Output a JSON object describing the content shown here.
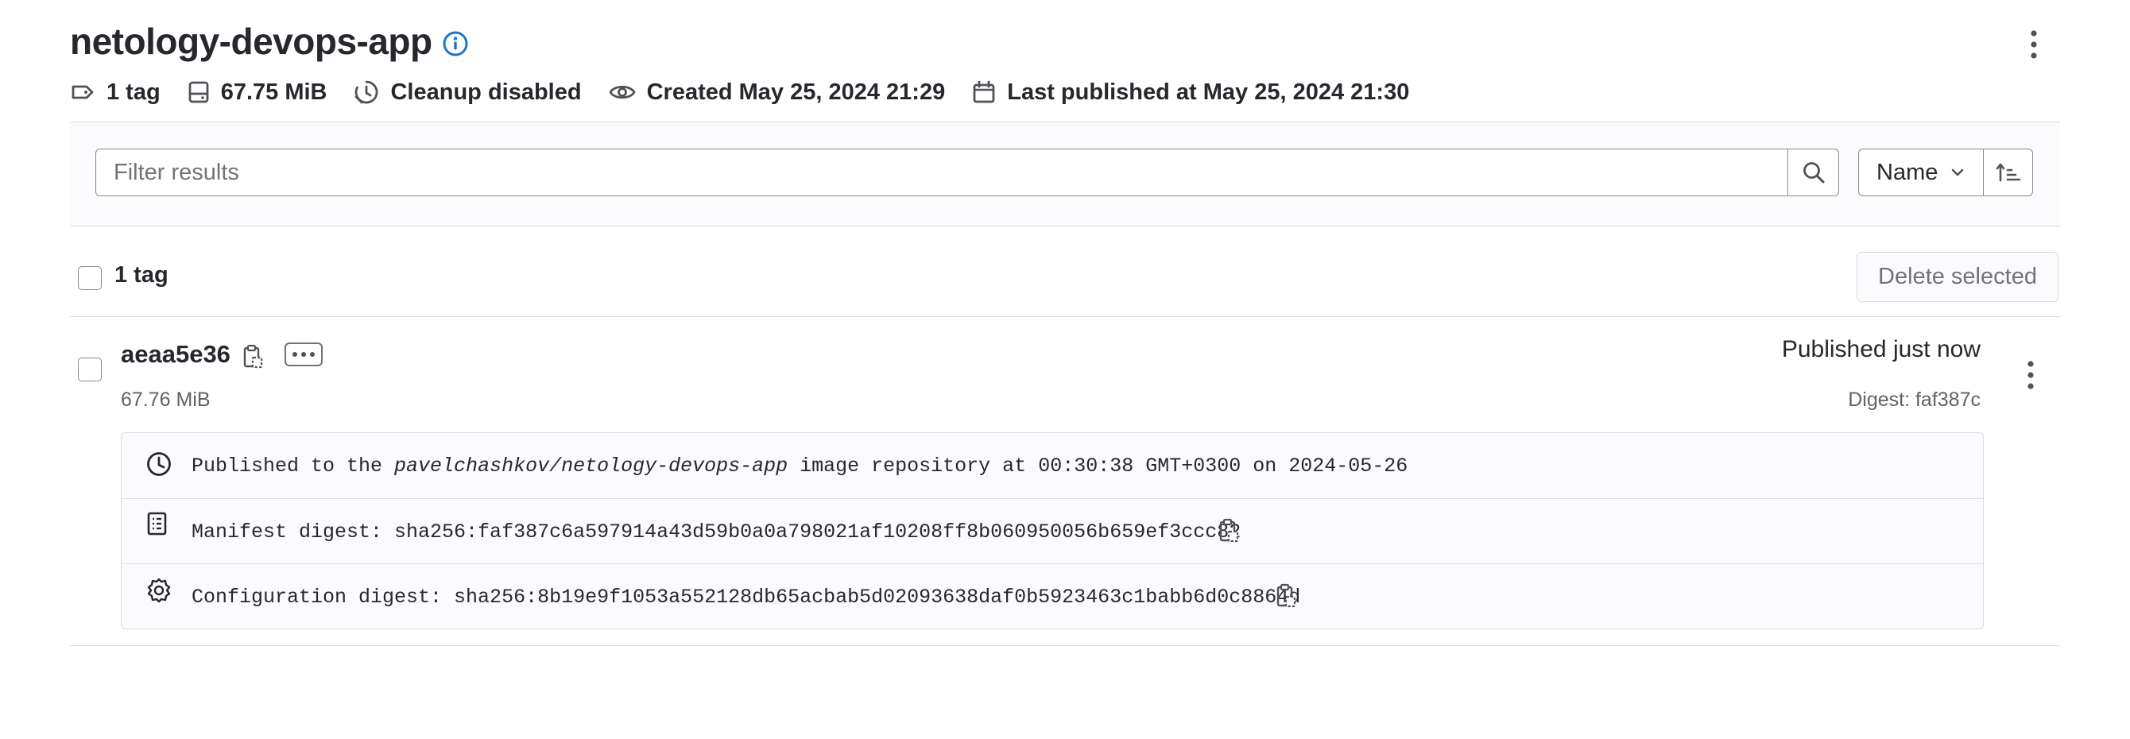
{
  "header": {
    "title": "netology-devops-app",
    "info_icon": "info-circle-icon",
    "menu_icon": "kebab-vertical-icon"
  },
  "meta": [
    {
      "icon": "label-icon",
      "text": "1 tag"
    },
    {
      "icon": "disk-icon",
      "text": "67.75 MiB"
    },
    {
      "icon": "cleanup-clock-icon",
      "text": "Cleanup disabled"
    },
    {
      "icon": "eye-icon",
      "text": "Created May 25, 2024 21:29"
    },
    {
      "icon": "calendar-icon",
      "text": "Last published at May 25, 2024 21:30"
    }
  ],
  "filter": {
    "placeholder": "Filter results",
    "value": "",
    "search_icon": "search-icon",
    "sort_label": "Name",
    "sort_direction_icon": "sort-ascending-icon"
  },
  "list_header": {
    "count_label": "1 tag",
    "delete_label": "Delete selected"
  },
  "tags": [
    {
      "name": "aeaa5e36",
      "size": "67.76 MiB",
      "published": "Published just now",
      "digest": "Digest: faf387c",
      "details": {
        "published_prefix": "Published to the ",
        "published_repo": "pavelchashkov/netology-devops-app",
        "published_suffix": " image repository at 00:30:38 GMT+0300 on 2024-05-26",
        "manifest": "Manifest digest: sha256:faf387c6a597914a43d59b0a0a798021af10208ff8b060950056b659ef3ccc82",
        "configuration": "Configuration digest: sha256:8b19e9f1053a552128db65acbab5d02093638daf0b5923463c1babb6d0c8864d"
      }
    }
  ],
  "colors": {
    "text": "#28272d",
    "muted": "#737278",
    "border": "#dcdcde",
    "info_blue": "#1f75cb",
    "panel_bg": "#fbfafd"
  }
}
